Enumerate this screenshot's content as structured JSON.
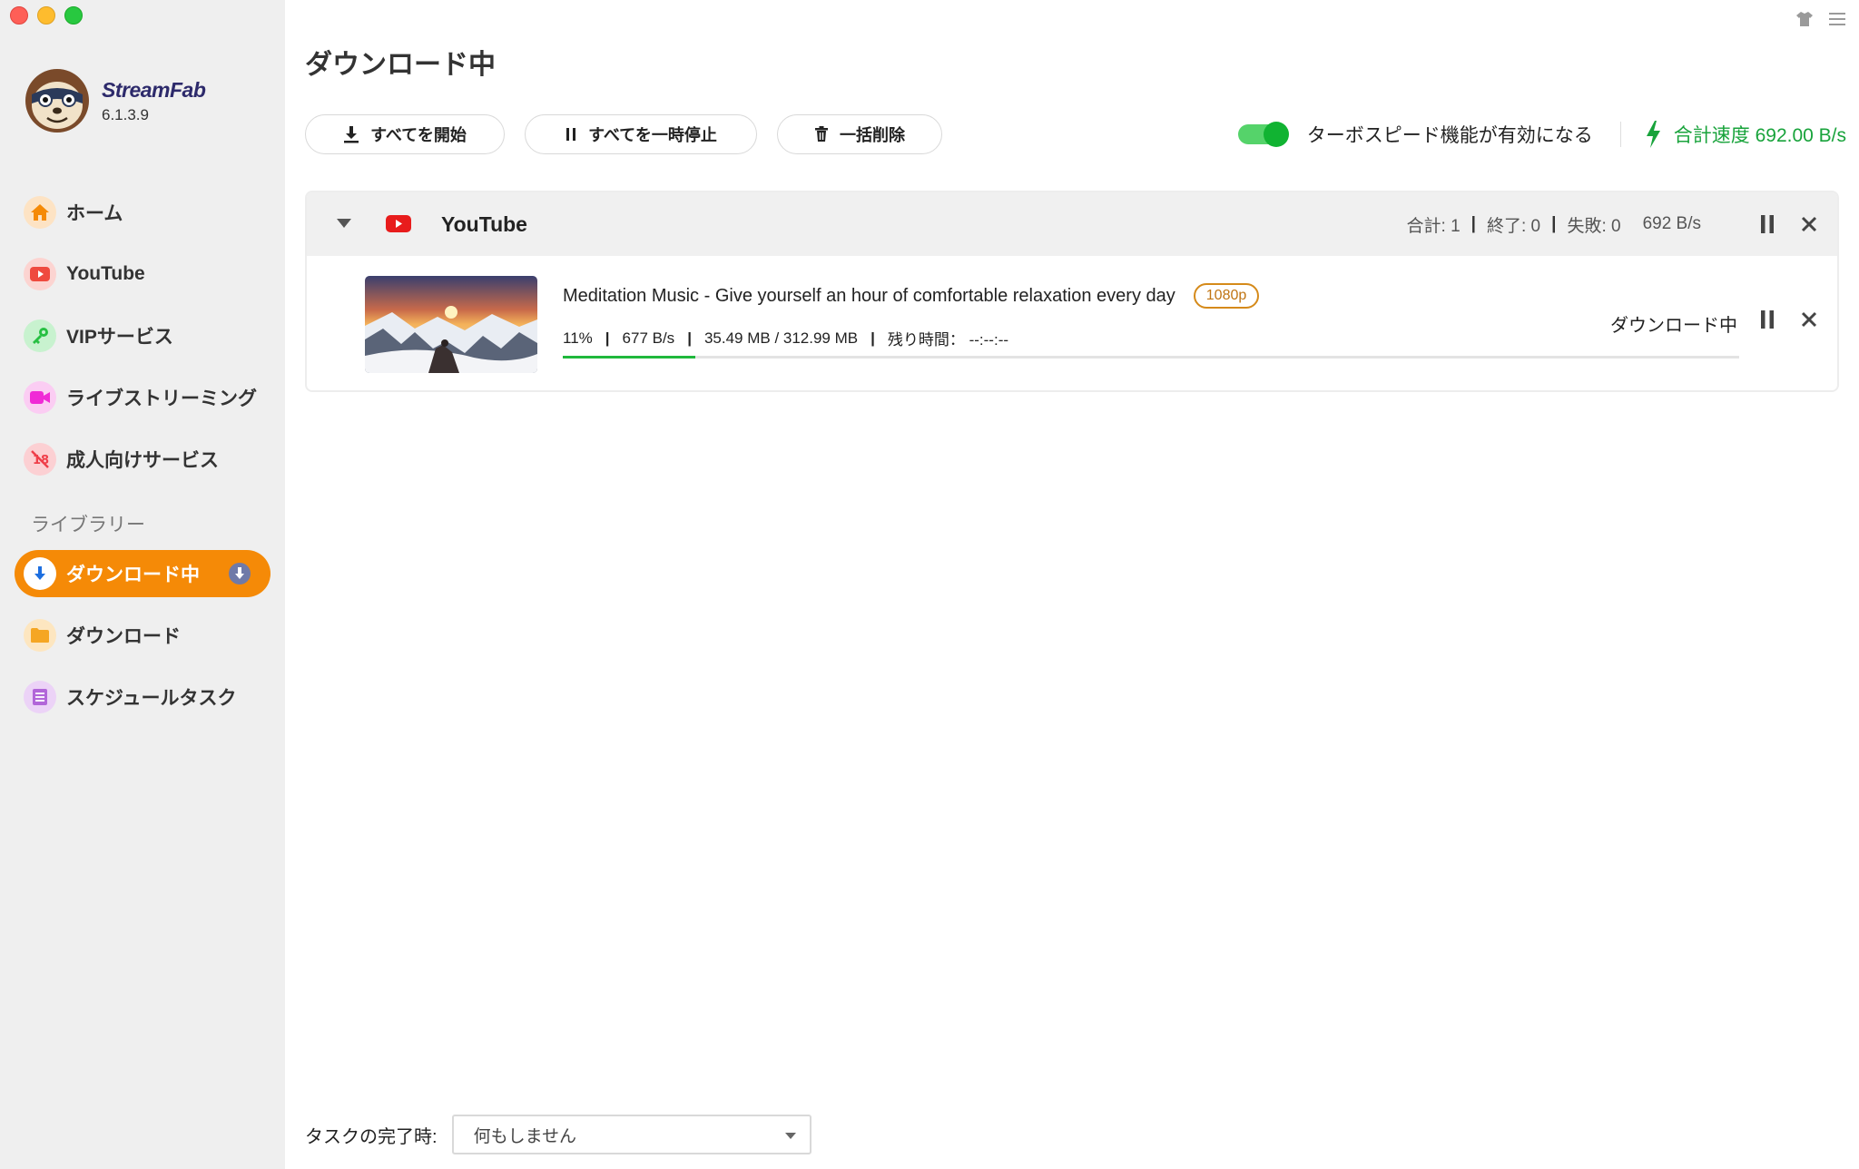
{
  "app": {
    "brand_name": "StreamFab",
    "version": "6.1.3.9"
  },
  "sidebar": {
    "items": [
      {
        "label": "ホーム",
        "icon": "home-icon",
        "color": "#f58a07"
      },
      {
        "label": "YouTube",
        "icon": "youtube-icon",
        "color": "#ef4a3f"
      },
      {
        "label": "VIPサービス",
        "icon": "key-icon",
        "color": "#27c043"
      },
      {
        "label": "ライブストリーミング",
        "icon": "video-camera-icon",
        "color": "#f02ad6"
      },
      {
        "label": "成人向けサービス",
        "icon": "adult-block-icon",
        "color": "#ef3f4a"
      }
    ],
    "library_title": "ライブラリー",
    "library_items": [
      {
        "label": "ダウンロード中",
        "icon": "download-arrow-icon",
        "active": true
      },
      {
        "label": "ダウンロード",
        "icon": "folder-icon",
        "color": "#f5a623"
      },
      {
        "label": "スケジュールタスク",
        "icon": "schedule-list-icon",
        "color": "#b266d9"
      }
    ]
  },
  "main": {
    "title": "ダウンロード中",
    "toolbar": {
      "start_all": "すべてを開始",
      "pause_all": "すべてを一時停止",
      "delete_all": "一括削除"
    },
    "turbo": {
      "label": "ターボスピード機能が有効になる",
      "enabled": true
    },
    "total_speed": "合計速度 692.00 B/s",
    "group": {
      "name": "YouTube",
      "total": "合計: 1",
      "done": "終了: 0",
      "failed": "失敗: 0",
      "speed": "692 B/s"
    },
    "task": {
      "title": "Meditation Music - Give yourself an hour of comfortable relaxation every day",
      "quality": "1080p",
      "percent": "11%",
      "speed": "677 B/s",
      "size": "35.49 MB / 312.99 MB",
      "remaining": "残り時間： --:--:--",
      "progress": 0.113,
      "status": "ダウンロード中"
    },
    "footer": {
      "label": "タスクの完了時:",
      "selected": "何もしません"
    }
  },
  "colors": {
    "accent": "#f58a07",
    "green": "#18a33b",
    "youtube_red": "#e81c1c"
  }
}
